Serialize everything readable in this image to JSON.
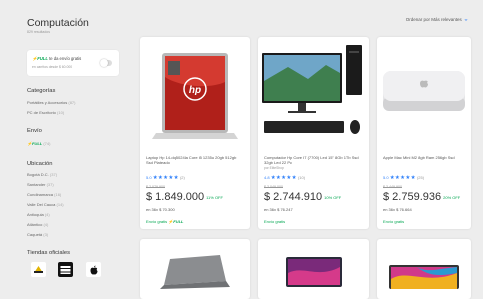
{
  "header": {
    "title": "Computación",
    "results": "829 resultados",
    "sort": "Ordenar por  Más relevantes"
  },
  "full_filter": {
    "badge": "⚡FULL",
    "label": " te da envío gratis",
    "sub": "en carritos desde $ 60.000"
  },
  "sidebar": {
    "categories_title": "Categorías",
    "categories": [
      {
        "label": "Portátiles y Accesorios",
        "count": "(87)"
      },
      {
        "label": "PC de Escritorio",
        "count": "(10)"
      }
    ],
    "shipping_title": "Envío",
    "shipping": [
      {
        "label": "⚡FULL",
        "count": "(74)"
      }
    ],
    "location_title": "Ubicación",
    "locations": [
      {
        "label": "Bogotá D.C.",
        "count": "(37)"
      },
      {
        "label": "Santander",
        "count": "(37)"
      },
      {
        "label": "Cundinamarca",
        "count": "(16)"
      },
      {
        "label": "Valle Del Cauca",
        "count": "(14)"
      },
      {
        "label": "Antioquia",
        "count": "(4)"
      },
      {
        "label": "Atlántico",
        "count": "(4)"
      },
      {
        "label": "Caquetá",
        "count": "(3)"
      }
    ],
    "stores_title": "Tiendas oficiales",
    "stores": [
      "store-logo-1",
      "store-logo-2",
      "apple-store-logo"
    ]
  },
  "products": [
    {
      "title": "Laptop Hp 14-dq5024la Core i5 1235u 20gb 512gb Ssd Plateado",
      "brand": "",
      "rating": "5.0",
      "stars": "★★★★★",
      "reviews": "(2)",
      "old_price": "$ 2.079.900",
      "price": "$ 1.849.000",
      "discount": "11% OFF",
      "installments": "en 36x $ 70.300",
      "shipping": "Envío gratis",
      "full": "⚡FULL"
    },
    {
      "title": "Computador Hp Core I7 (7700) Led 15\" 8Gb 1Tb Ssd 32gb Led 22 Pc",
      "brand": "por EliteShop",
      "rating": "4.8",
      "stars": "★★★★★",
      "reviews": "(10)",
      "old_price": "$ 3.049.000",
      "price": "$ 2.744.910",
      "discount": "10% OFF",
      "installments": "en 36x $ 76.247",
      "shipping": "Envío gratis",
      "full": ""
    },
    {
      "title": "Apple Mac Mini M2 8gb Ram 256gb Ssd",
      "brand": "",
      "rating": "5.0",
      "stars": "★★★★★",
      "reviews": "(25)",
      "old_price": "$ 3.449.900",
      "price": "$ 2.759.936",
      "discount": "20% OFF",
      "installments": "en 36x $ 76.664",
      "shipping": "Envío gratis",
      "full": ""
    }
  ],
  "colors": {
    "accent": "#3483fa",
    "green": "#00a650",
    "bg": "#ededed"
  }
}
